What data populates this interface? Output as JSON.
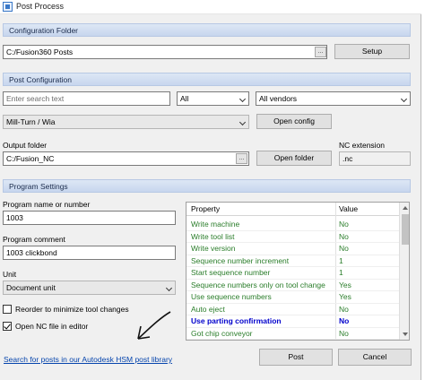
{
  "window": {
    "title": "Post Process"
  },
  "config_folder": {
    "header": "Configuration Folder",
    "path": "C:/Fusion360 Posts",
    "browse_label": "...",
    "setup_label": "Setup"
  },
  "post_config": {
    "header": "Post Configuration",
    "search_placeholder": "Enter search text",
    "filter_type": "All",
    "filter_vendor": "All vendors",
    "selected_post": "Mill-Turn / Wia",
    "open_config_label": "Open config",
    "output_folder_label": "Output folder",
    "output_folder": "C:/Fusion_NC",
    "browse_label": "...",
    "open_folder_label": "Open folder",
    "nc_extension_label": "NC extension",
    "nc_extension": ".nc"
  },
  "program_settings": {
    "header": "Program Settings",
    "program_name_label": "Program name or number",
    "program_name": "1003",
    "program_comment_label": "Program comment",
    "program_comment": "1003 clickbond",
    "unit_label": "Unit",
    "unit": "Document unit",
    "reorder_label": "Reorder to minimize tool changes",
    "reorder_checked": false,
    "open_nc_label": "Open NC file in editor",
    "open_nc_checked": true
  },
  "properties": {
    "col_property": "Property",
    "col_value": "Value",
    "rows": [
      {
        "name": "Write machine",
        "value": "No"
      },
      {
        "name": "Write tool list",
        "value": "No"
      },
      {
        "name": "Write version",
        "value": "No"
      },
      {
        "name": "Sequence number increment",
        "value": "1"
      },
      {
        "name": "Start sequence number",
        "value": "1"
      },
      {
        "name": "Sequence numbers only on tool change",
        "value": "Yes"
      },
      {
        "name": "Use sequence numbers",
        "value": "Yes"
      },
      {
        "name": "Auto eject",
        "value": "No"
      },
      {
        "name": "Use parting confirmation",
        "value": "No",
        "selected": true
      },
      {
        "name": "Got chip conveyor",
        "value": "No"
      }
    ]
  },
  "footer": {
    "library_link": "Search for posts in our Autodesk HSM post library",
    "post_label": "Post",
    "cancel_label": "Cancel"
  },
  "colors": {
    "section_header": "#c7d6ee",
    "property_text": "#2a7d2a",
    "selected_property_text": "#0000cc",
    "link": "#0645ad"
  }
}
